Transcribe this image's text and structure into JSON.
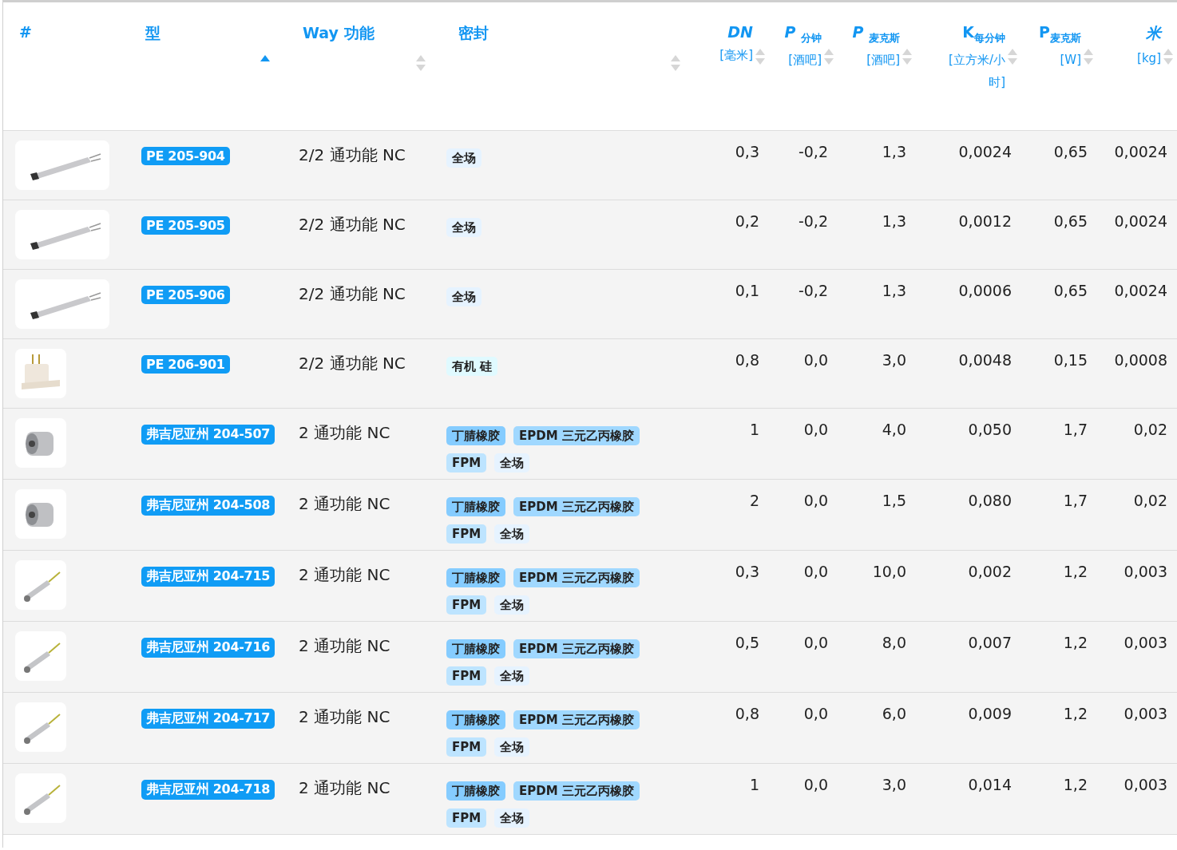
{
  "table": {
    "columns": [
      {
        "label": "#",
        "kind": "text"
      },
      {
        "label": "型",
        "kind": "text",
        "sorted": true
      },
      {
        "label": "Way 功能",
        "kind": "text",
        "sorted": false
      },
      {
        "label": "密封",
        "kind": "text",
        "sorted": false
      },
      {
        "label": "*DN*",
        "unit": "[毫米]",
        "kind": "num",
        "sorted": false
      },
      {
        "label": "*P* $_{分钟}$",
        "unit": "[酒吧]",
        "kind": "num",
        "sorted": false
      },
      {
        "label": "*P* $_{麦克斯}$",
        "unit": "[酒吧]",
        "kind": "num",
        "sorted": false
      },
      {
        "label": "K$_{每分钟}$",
        "unit": "[立方米/小时]",
        "kind": "num",
        "sorted": false
      },
      {
        "label": "P$_{麦克斯}$",
        "unit": "[W]",
        "kind": "num",
        "sorted": false
      },
      {
        "label": "*米*",
        "unit": "[kg]",
        "kind": "num",
        "sorted": false
      }
    ],
    "rows": [
      {
        "kind": "rod",
        "model": "PE 205-904",
        "function": "2/2 通功能 NC",
        "seals": [
          {
            "label": "全场",
            "color": "#e6f3ff"
          }
        ],
        "values": [
          "0,3",
          "-0,2",
          "1,3",
          "0,0024",
          "0,65",
          "0,0024"
        ]
      },
      {
        "kind": "rod",
        "model": "PE 205-905",
        "function": "2/2 通功能 NC",
        "seals": [
          {
            "label": "全场",
            "color": "#e6f3ff"
          }
        ],
        "values": [
          "0,2",
          "-0,2",
          "1,3",
          "0,0012",
          "0,65",
          "0,0024"
        ]
      },
      {
        "kind": "rod",
        "model": "PE 205-906",
        "function": "2/2 通功能 NC",
        "seals": [
          {
            "label": "全场",
            "color": "#e6f3ff"
          }
        ],
        "values": [
          "0,1",
          "-0,2",
          "1,3",
          "0,0006",
          "0,65",
          "0,0024"
        ]
      },
      {
        "kind": "block",
        "model": "PE 206-901",
        "function": "2/2 通功能 NC",
        "seals": [
          {
            "label": "有机 硅",
            "color": "#e0faff"
          }
        ],
        "values": [
          "0,8",
          "0,0",
          "3,0",
          "0,0048",
          "0,15",
          "0,0008"
        ]
      },
      {
        "kind": "cylinder",
        "model": "弗吉尼亚州 204-507",
        "function": "2 通功能 NC",
        "seals": [
          {
            "label": "丁腈橡胶",
            "color": "#85ccff"
          },
          {
            "label": "EPDM 三元乙丙橡胶",
            "color": "#a0d8ff"
          },
          {
            "label": "FPM",
            "color": "#bde4ff"
          },
          {
            "label": "全场",
            "color": "#e6f3ff"
          }
        ],
        "values": [
          "1",
          "0,0",
          "4,0",
          "0,050",
          "1,7",
          "0,02"
        ]
      },
      {
        "kind": "cylinder",
        "model": "弗吉尼亚州 204-508",
        "function": "2 通功能 NC",
        "seals": [
          {
            "label": "丁腈橡胶",
            "color": "#85ccff"
          },
          {
            "label": "EPDM 三元乙丙橡胶",
            "color": "#a0d8ff"
          },
          {
            "label": "FPM",
            "color": "#bde4ff"
          },
          {
            "label": "全场",
            "color": "#e6f3ff"
          }
        ],
        "values": [
          "2",
          "0,0",
          "1,5",
          "0,080",
          "1,7",
          "0,02"
        ]
      },
      {
        "kind": "probe",
        "model": "弗吉尼亚州 204-715",
        "function": "2 通功能 NC",
        "seals": [
          {
            "label": "丁腈橡胶",
            "color": "#85ccff"
          },
          {
            "label": "EPDM 三元乙丙橡胶",
            "color": "#a0d8ff"
          },
          {
            "label": "FPM",
            "color": "#bde4ff"
          },
          {
            "label": "全场",
            "color": "#e6f3ff"
          }
        ],
        "values": [
          "0,3",
          "0,0",
          "10,0",
          "0,002",
          "1,2",
          "0,003"
        ]
      },
      {
        "kind": "probe",
        "model": "弗吉尼亚州 204-716",
        "function": "2 通功能 NC",
        "seals": [
          {
            "label": "丁腈橡胶",
            "color": "#85ccff"
          },
          {
            "label": "EPDM 三元乙丙橡胶",
            "color": "#a0d8ff"
          },
          {
            "label": "FPM",
            "color": "#bde4ff"
          },
          {
            "label": "全场",
            "color": "#e6f3ff"
          }
        ],
        "values": [
          "0,5",
          "0,0",
          "8,0",
          "0,007",
          "1,2",
          "0,003"
        ]
      },
      {
        "kind": "probe",
        "model": "弗吉尼亚州 204-717",
        "function": "2 通功能 NC",
        "seals": [
          {
            "label": "丁腈橡胶",
            "color": "#85ccff"
          },
          {
            "label": "EPDM 三元乙丙橡胶",
            "color": "#a0d8ff"
          },
          {
            "label": "FPM",
            "color": "#bde4ff"
          },
          {
            "label": "全场",
            "color": "#e6f3ff"
          }
        ],
        "values": [
          "0,8",
          "0,0",
          "6,0",
          "0,009",
          "1,2",
          "0,003"
        ]
      },
      {
        "kind": "probe",
        "model": "弗吉尼亚州 204-718",
        "function": "2 通功能 NC",
        "seals": [
          {
            "label": "丁腈橡胶",
            "color": "#85ccff"
          },
          {
            "label": "EPDM 三元乙丙橡胶",
            "color": "#a0d8ff"
          },
          {
            "label": "FPM",
            "color": "#bde4ff"
          },
          {
            "label": "全场",
            "color": "#e6f3ff"
          }
        ],
        "values": [
          "1",
          "0,0",
          "3,0",
          "0,014",
          "1,2",
          "0,003"
        ]
      }
    ]
  }
}
